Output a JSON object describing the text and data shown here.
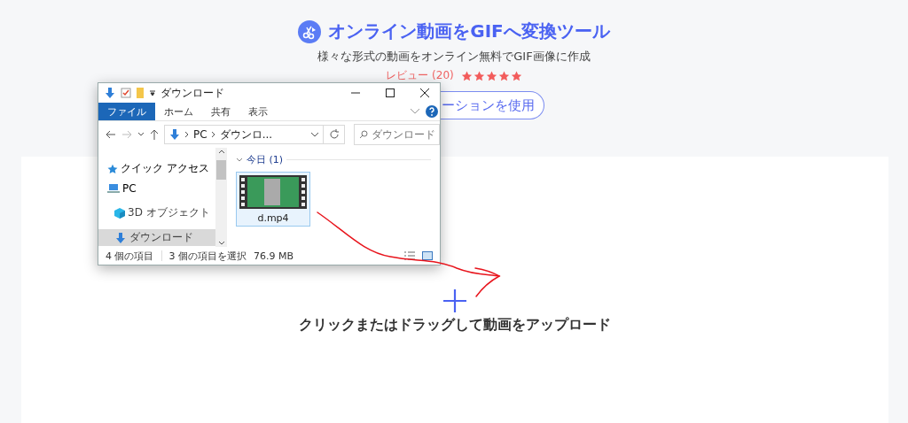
{
  "header": {
    "title": "オンライン動画をGIFへ変換ツール",
    "subtitle": "様々な形式の動画をオンライン無料でGIF画像に作成",
    "review_label": "レビュー (20)",
    "stars": 5,
    "button": "ーションを使用"
  },
  "explorer": {
    "title": "ダウンロード",
    "ribbon_tabs": [
      {
        "label": "ファイル",
        "selected": true
      },
      {
        "label": "ホーム",
        "selected": false
      },
      {
        "label": "共有",
        "selected": false
      },
      {
        "label": "表示",
        "selected": false
      }
    ],
    "path": [
      "PC",
      "ダウンロ..."
    ],
    "search": {
      "placeholder": "ダウンロード"
    },
    "nav": [
      {
        "label": "クイック アクセス",
        "kind": "quick",
        "selected": false
      },
      {
        "label": "PC",
        "kind": "pc",
        "selected": false
      },
      {
        "label": "3D オブジェクト",
        "kind": "objects3d",
        "selected": false
      },
      {
        "label": "ダウンロード",
        "kind": "download",
        "selected": true
      }
    ],
    "group": {
      "label": "今日 (1)"
    },
    "files": [
      {
        "name": "d.mp4",
        "selected": true
      }
    ],
    "status": {
      "count": "4 個の項目",
      "selection": "3 個の項目を選択",
      "size": "76.9 MB"
    }
  },
  "upload": {
    "label": "クリックまたはドラッグして動画をアップロード"
  }
}
